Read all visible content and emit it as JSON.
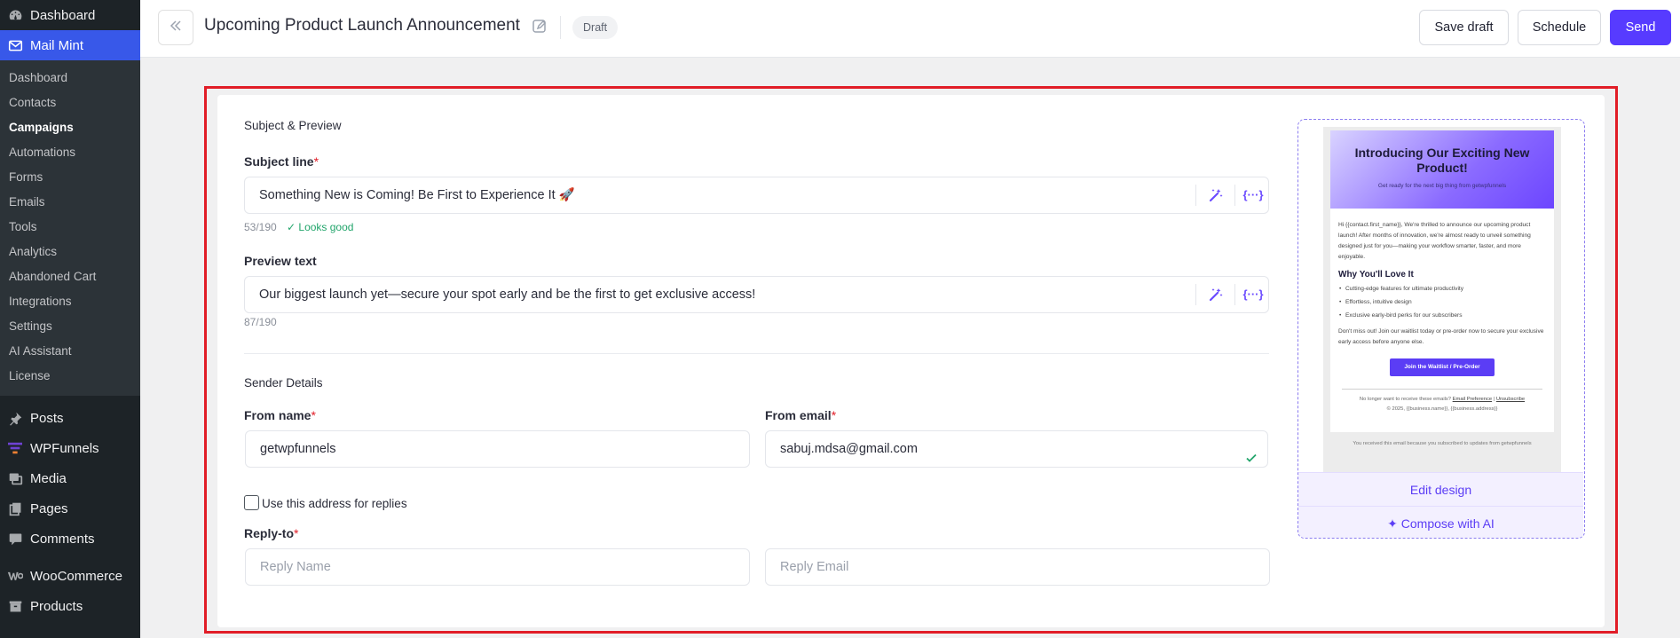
{
  "sidebar": {
    "dashboard": "Dashboard",
    "mailmint": "Mail Mint",
    "submenu": [
      "Dashboard",
      "Contacts",
      "Campaigns",
      "Automations",
      "Forms",
      "Emails",
      "Tools",
      "Analytics",
      "Abandoned Cart",
      "Integrations",
      "Settings",
      "AI Assistant",
      "License"
    ],
    "posts": "Posts",
    "wpfunnels": "WPFunnels",
    "media": "Media",
    "pages": "Pages",
    "comments": "Comments",
    "woocommerce": "WooCommerce",
    "products": "Products"
  },
  "header": {
    "title": "Upcoming Product Launch Announcement",
    "status": "Draft",
    "save_draft": "Save draft",
    "schedule": "Schedule",
    "send": "Send"
  },
  "form": {
    "subject_section": "Subject & Preview",
    "subject_label": "Subject line",
    "subject_value": "Something New is Coming! Be First to Experience It 🚀",
    "subject_count": "53/190",
    "subject_status": "✓ Looks good",
    "preview_label": "Preview text",
    "preview_value": "Our biggest launch yet—secure your spot early and be the first to get exclusive access!",
    "preview_count": "87/190",
    "merge_tag": "{···}",
    "required_mark": "*",
    "sender_section": "Sender Details",
    "from_name_label": "From name",
    "from_name_value": "getwpfunnels",
    "from_email_label": "From email",
    "from_email_value": "sabuj.mdsa@gmail.com",
    "use_reply_label": "Use this address for replies",
    "reply_to_label": "Reply-to",
    "reply_name_placeholder": "Reply Name",
    "reply_email_placeholder": "Reply Email"
  },
  "preview_panel": {
    "headline": "Introducing Our Exciting New Product!",
    "subheadline": "Get ready for the next big thing from getwpfunnels",
    "intro": "Hi {{contact.first_name}}, We're thrilled to announce our upcoming product launch! After months of innovation, we're almost ready to unveil something designed just for you—making your workflow smarter, faster, and more enjoyable.",
    "section_title": "Why You'll Love It",
    "bullets": [
      "Cutting-edge features for ultimate productivity",
      "Effortless, intuitive design",
      "Exclusive early-bird perks for our subscribers"
    ],
    "closing": "Don't miss out! Join our waitlist today or pre-order now to secure your exclusive early access before anyone else.",
    "cta": "Join the Waitlist / Pre-Order",
    "footer_line1_text": "No longer want to receive these emails? ",
    "footer_link1": "Email Preference",
    "footer_link_sep": " | ",
    "footer_link2": "Unsubscribe",
    "footer_line2": "© 2025, {{business.name}}, {{business.address}}",
    "outer_note": "You received this email because you subscribed to updates from getwpfunnels",
    "edit_design": "Edit design",
    "compose_ai": "✦ Compose with AI"
  },
  "colors": {
    "accent": "#573bff",
    "highlight_border": "#e11d27",
    "sidebar_bg": "#1d2327",
    "sidebar_active": "#3858e9"
  }
}
